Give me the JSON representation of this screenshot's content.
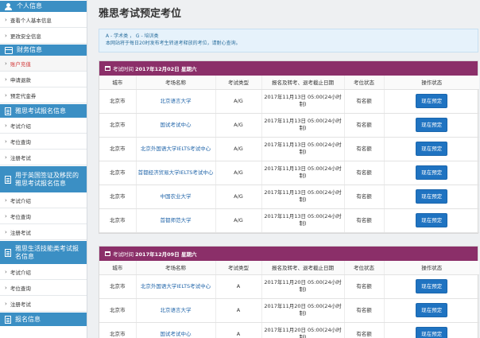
{
  "sidebar": {
    "sections": [
      {
        "title": "个人信息",
        "icon": "person-icon",
        "items": [
          {
            "label": "查看个人基本信息",
            "active": false
          },
          {
            "label": "更改安全信息",
            "active": false
          }
        ]
      },
      {
        "title": "财务信息",
        "icon": "card-icon",
        "items": [
          {
            "label": "账户充值",
            "active": true
          },
          {
            "label": "申请退款",
            "active": false
          },
          {
            "label": "预定代金券",
            "active": false
          }
        ]
      },
      {
        "title": "雅思考试报名信息",
        "icon": "document-icon",
        "items": [
          {
            "label": "考试介绍",
            "active": false
          },
          {
            "label": "考位查询",
            "active": false
          },
          {
            "label": "注册考试",
            "active": false
          }
        ]
      },
      {
        "title": "用于英国签证及移民的雅思考试报名信息",
        "icon": "document-icon",
        "items": [
          {
            "label": "考试介绍",
            "active": false
          },
          {
            "label": "考位查询",
            "active": false
          },
          {
            "label": "注册考试",
            "active": false
          }
        ]
      },
      {
        "title": "雅思生活技能类考试报名信息",
        "icon": "document-icon",
        "items": [
          {
            "label": "考试介绍",
            "active": false
          },
          {
            "label": "考位查询",
            "active": false
          },
          {
            "label": "注册考试",
            "active": false
          }
        ]
      },
      {
        "title": "报名信息",
        "icon": "document-icon",
        "items": []
      }
    ]
  },
  "page": {
    "title": "雅思考试预定考位",
    "notice_line1": "A - 学术类 ， G - 培训类",
    "notice_line2": "本网站将于每日20时发布考生转退考释放的考位，请耐心查询。"
  },
  "table_headers": [
    "城市",
    "考场名称",
    "考试类型",
    "报名及转考、退考截止日期",
    "考位状态",
    "操作状态"
  ],
  "sessions": [
    {
      "prefix": "考试时间",
      "date": "2017年12月02日 星期六",
      "rows": [
        {
          "city": "北京市",
          "venue": "北京语言大学",
          "type": "A/G",
          "deadline": "2017年11月13日 05:00(24小时制)",
          "status": "有名额",
          "action": "现在预定"
        },
        {
          "city": "北京市",
          "venue": "国试考试中心",
          "type": "A/G",
          "deadline": "2017年11月13日 05:00(24小时制)",
          "status": "有名额",
          "action": "现在预定"
        },
        {
          "city": "北京市",
          "venue": "北京外国语大学IELTS考试中心",
          "type": "A/G",
          "deadline": "2017年11月13日 05:00(24小时制)",
          "status": "有名额",
          "action": "现在预定"
        },
        {
          "city": "北京市",
          "venue": "首都经济贸易大学IELTS考试中心",
          "type": "A/G",
          "deadline": "2017年11月13日 05:00(24小时制)",
          "status": "有名额",
          "action": "现在预定"
        },
        {
          "city": "北京市",
          "venue": "中国农业大学",
          "type": "A/G",
          "deadline": "2017年11月13日 05:00(24小时制)",
          "status": "有名额",
          "action": "现在预定"
        },
        {
          "city": "北京市",
          "venue": "首都师范大学",
          "type": "A/G",
          "deadline": "2017年11月13日 05:00(24小时制)",
          "status": "有名额",
          "action": "现在预定"
        }
      ]
    },
    {
      "prefix": "考试时间",
      "date": "2017年12月09日 星期六",
      "rows": [
        {
          "city": "北京市",
          "venue": "北京外国语大学IELTS考试中心",
          "type": "A",
          "deadline": "2017年11月20日 05:00(24小时制)",
          "status": "有名额",
          "action": "现在预定"
        },
        {
          "city": "北京市",
          "venue": "北京语言大学",
          "type": "A",
          "deadline": "2017年11月20日 05:00(24小时制)",
          "status": "有名额",
          "action": "现在预定"
        },
        {
          "city": "北京市",
          "venue": "国试考试中心",
          "type": "A",
          "deadline": "2017年11月20日 05:00(24小时制)",
          "status": "有名额",
          "action": "现在预定"
        }
      ]
    }
  ],
  "colors": {
    "sidebar_header": "#3b8fc4",
    "session_header": "#8b2f69",
    "button": "#1f73c1",
    "active_nav": "#d23a3a"
  }
}
